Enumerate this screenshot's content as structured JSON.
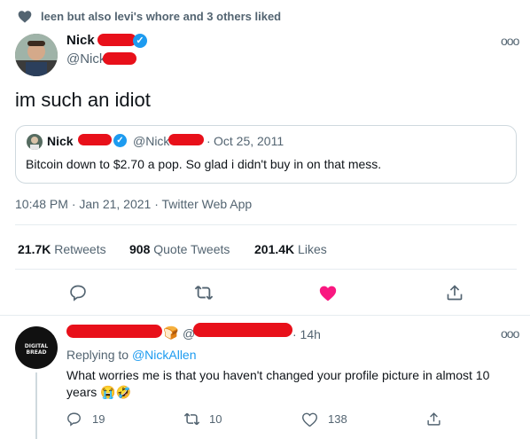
{
  "social_context": {
    "icon": "heart-icon",
    "text": "leen but also levi's whore and 3 others liked"
  },
  "main_tweet": {
    "author_name": "Nick",
    "author_handle": "@Nick",
    "verified_icon": "verified-badge-icon",
    "more_icon": "more-options-icon",
    "text": "im such an idiot",
    "quoted": {
      "author_name": "Nick",
      "author_handle": "@Nick",
      "separator": "·",
      "date": "Oct 25, 2011",
      "text": "Bitcoin down to $2.70 a pop. So glad i didn't buy in on that mess."
    },
    "timestamp": "10:48 PM · Jan 21, 2021 · Twitter Web App",
    "stats": {
      "retweets_count": "21.7K",
      "retweets_label": "Retweets",
      "quotes_count": "908",
      "quotes_label": "Quote Tweets",
      "likes_count": "201.4K",
      "likes_label": "Likes"
    },
    "actions": [
      "reply-icon",
      "retweet-icon",
      "like-icon-filled",
      "share-icon"
    ]
  },
  "reply_tweet": {
    "name_suffix_emoji": "🍞",
    "handle_fragment": "@",
    "time": "· 14h",
    "avatar_text": "DIGITAL BREAD",
    "replying_prefix": "Replying to ",
    "replying_to": "@NickAllen",
    "text": "What worries me is that you haven't changed your profile picture in almost 10 years",
    "emojis": "😭🤣",
    "reply_count": "19",
    "retweet_count": "10",
    "like_count": "138"
  },
  "colors": {
    "accent": "#1d9bf0",
    "like_red": "#f91880",
    "redaction": "#e8101a",
    "muted_text": "#536471"
  }
}
